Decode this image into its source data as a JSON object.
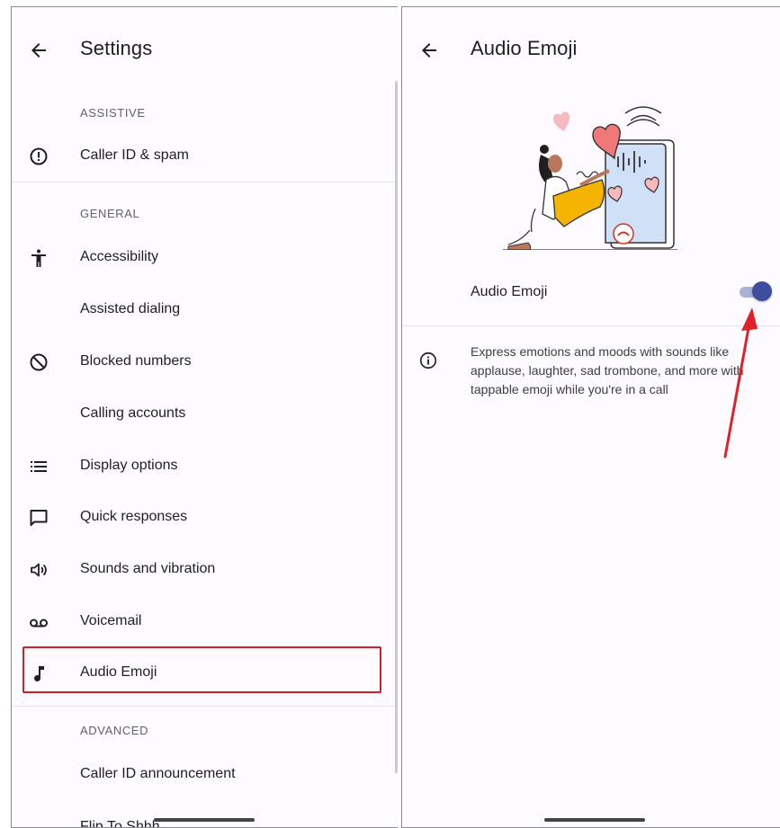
{
  "left": {
    "title": "Settings",
    "sections": {
      "assistive": "ASSISTIVE",
      "general": "GENERAL",
      "advanced": "ADVANCED"
    },
    "items": [
      {
        "label": "Caller ID & spam",
        "icon": "caller-id-alert-icon"
      },
      {
        "label": "Accessibility",
        "icon": "accessibility-icon"
      },
      {
        "label": "Assisted dialing",
        "icon": ""
      },
      {
        "label": "Blocked numbers",
        "icon": "block-icon"
      },
      {
        "label": "Calling accounts",
        "icon": ""
      },
      {
        "label": "Display options",
        "icon": "list-icon"
      },
      {
        "label": "Quick responses",
        "icon": "chat-bubble-icon"
      },
      {
        "label": "Sounds and vibration",
        "icon": "volume-icon"
      },
      {
        "label": "Voicemail",
        "icon": "voicemail-icon"
      },
      {
        "label": "Audio Emoji",
        "icon": "music-note-icon"
      },
      {
        "label": "Caller ID announcement",
        "icon": ""
      },
      {
        "label": "Flip To Shhh",
        "icon": ""
      }
    ],
    "highlight_color": "#d0202a"
  },
  "right": {
    "title": "Audio Emoji",
    "toggle": {
      "label": "Audio Emoji",
      "state": "on"
    },
    "description": "Express emotions and moods with sounds like applause, laughter, sad trombone, and more with tappable emoji while you're in a call",
    "accent": "#3f4e9c",
    "annotation_arrow_color": "#e0202a"
  }
}
